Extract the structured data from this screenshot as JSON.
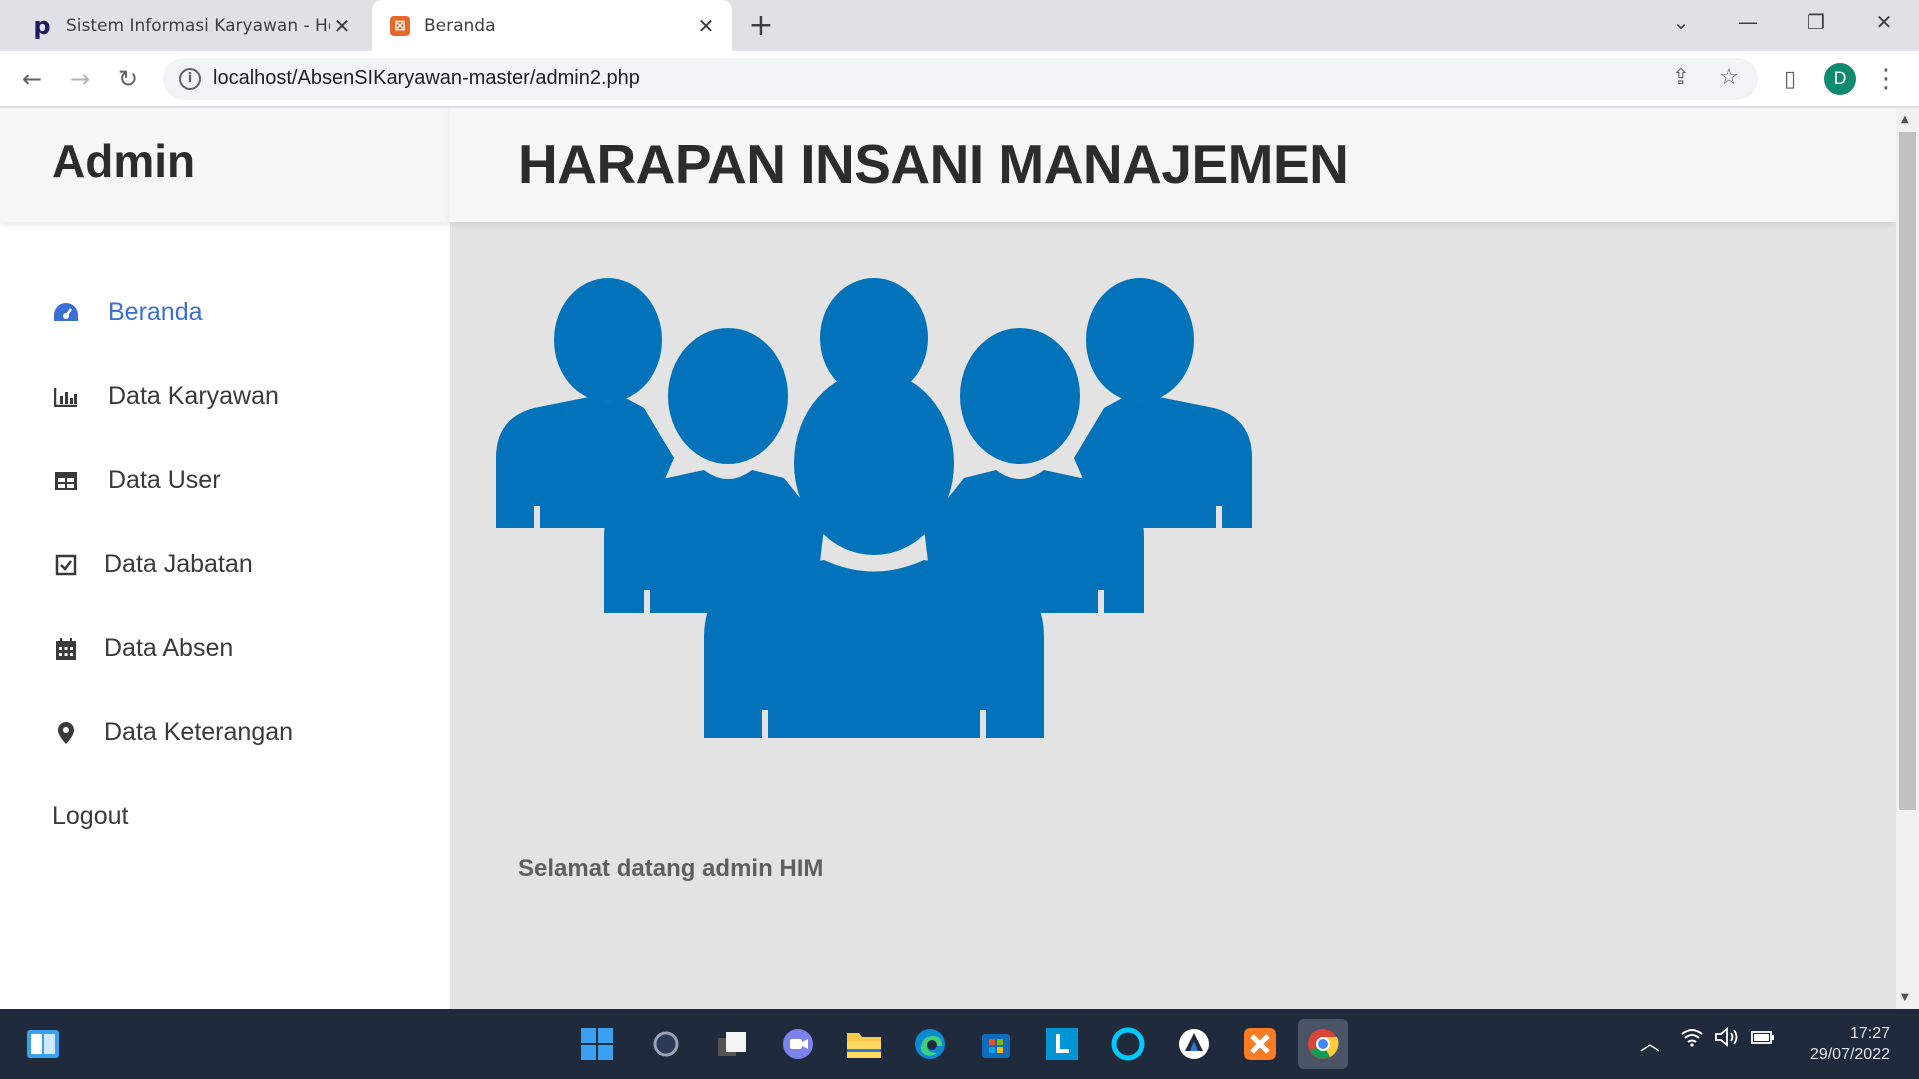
{
  "browser": {
    "tabs": [
      {
        "title": "Sistem Informasi Karyawan - Hom",
        "favicon": "p"
      },
      {
        "title": "Beranda",
        "favicon": "xampp-icon"
      }
    ],
    "url": "localhost/AbsenSIKaryawan-master/admin2.php",
    "profile_initial": "D"
  },
  "sidebar": {
    "title": "Admin",
    "items": [
      {
        "label": "Beranda",
        "icon": "dashboard-icon",
        "active": true
      },
      {
        "label": "Data Karyawan",
        "icon": "bar-chart-icon"
      },
      {
        "label": "Data User",
        "icon": "table-icon"
      },
      {
        "label": "Data Jabatan",
        "icon": "check-square-icon"
      },
      {
        "label": "Data Absen",
        "icon": "calendar-icon"
      },
      {
        "label": "Data Keterangan",
        "icon": "map-pin-icon"
      }
    ],
    "logout": "Logout"
  },
  "main": {
    "header": "HARAPAN INSANI MANAJEMEN",
    "welcome": "Selamat datang admin HIM",
    "hero_icon": "people-group-icon",
    "hero_color": "#0272bb"
  },
  "taskbar": {
    "time": "17:27",
    "date": "29/07/2022"
  },
  "colors": {
    "accent": "#3b6fd4",
    "sidebar_bg": "#ffffff",
    "main_bg": "#e3e3e3"
  }
}
